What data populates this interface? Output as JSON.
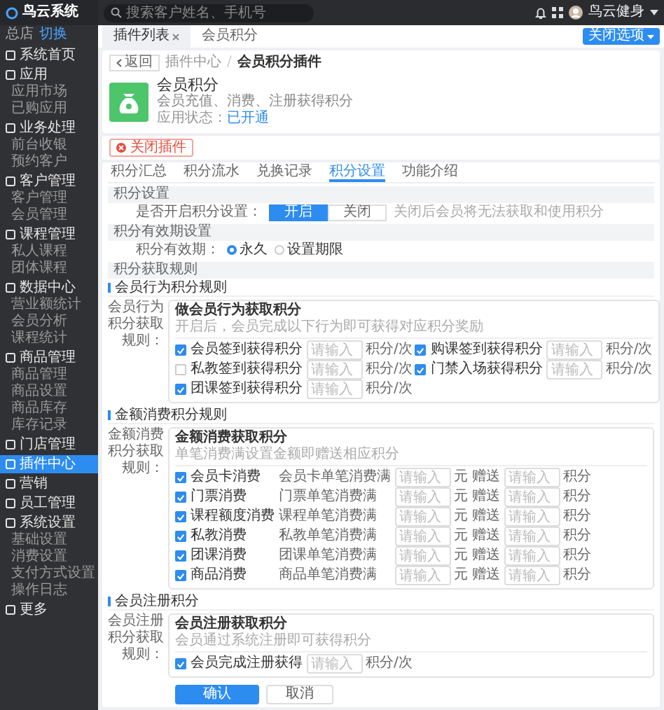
{
  "sidebar": {
    "brand": "鸟云系统",
    "store": "总店",
    "switch": "切换",
    "items": [
      {
        "label": "系统首页",
        "selected": false
      },
      {
        "label": "应用",
        "selected": false,
        "children": [
          {
            "label": "应用市场",
            "selected": false
          },
          {
            "label": "已购应用",
            "selected": false
          }
        ]
      },
      {
        "label": "业务处理",
        "selected": false,
        "children": [
          {
            "label": "前台收银",
            "selected": false
          },
          {
            "label": "预约客户",
            "selected": false
          }
        ]
      },
      {
        "label": "客户管理",
        "selected": false,
        "children": [
          {
            "label": "客户管理",
            "selected": false
          },
          {
            "label": "会员管理",
            "selected": false
          }
        ]
      },
      {
        "label": "课程管理",
        "selected": false,
        "children": [
          {
            "label": "私人课程",
            "selected": false
          },
          {
            "label": "团体课程",
            "selected": false
          }
        ]
      },
      {
        "label": "数据中心",
        "selected": false,
        "children": [
          {
            "label": "营业额统计",
            "selected": false
          },
          {
            "label": "会员分析",
            "selected": false
          },
          {
            "label": "课程统计",
            "selected": false
          }
        ]
      },
      {
        "label": "商品管理",
        "selected": false,
        "children": [
          {
            "label": "商品管理",
            "selected": false
          },
          {
            "label": "商品设置",
            "selected": false
          },
          {
            "label": "商品库存",
            "selected": false
          },
          {
            "label": "库存记录",
            "selected": false
          }
        ]
      },
      {
        "label": "门店管理",
        "selected": false
      },
      {
        "label": "插件中心",
        "selected": true
      },
      {
        "label": "营销",
        "selected": false
      },
      {
        "label": "员工管理",
        "selected": false
      },
      {
        "label": "系统设置",
        "selected": false,
        "children": [
          {
            "label": "基础设置",
            "selected": false
          },
          {
            "label": "消费设置",
            "selected": false
          },
          {
            "label": "支付方式设置",
            "selected": false
          },
          {
            "label": "操作日志",
            "selected": false
          }
        ]
      },
      {
        "label": "更多",
        "selected": false
      }
    ]
  },
  "topbar": {
    "search": {
      "placeholder": "搜索客户姓名、手机号"
    },
    "user": "鸟云健身"
  },
  "page_tabs": {
    "tabs": [
      {
        "label": "插件列表",
        "selected": true,
        "closable": true
      },
      {
        "label": "会员积分",
        "selected": false,
        "closable": false
      }
    ],
    "menu_button": "关闭选项"
  },
  "header": {
    "back": "返回",
    "breadcrumb": [
      "插件中心",
      "会员积分插件"
    ],
    "separator": "/",
    "plugin": {
      "name": "会员积分",
      "description": "会员充值、消费、注册获得积分",
      "status_label": "应用状态：",
      "status": "已开通"
    }
  },
  "close_button": "关闭插件",
  "tabs": [
    {
      "label": "积分汇总",
      "selected": false
    },
    {
      "label": "积分流水",
      "selected": false
    },
    {
      "label": "兑换记录",
      "selected": false
    },
    {
      "label": "积分设置",
      "selected": true
    },
    {
      "label": "功能介绍",
      "selected": false
    }
  ],
  "sections": [
    {
      "kind": "toggle",
      "title": "积分设置",
      "label": "是否开启积分设置：",
      "options": [
        {
          "label": "开启",
          "selected": true
        },
        {
          "label": "关闭",
          "selected": false
        }
      ],
      "hint": "关闭后会员将无法获取和使用积分"
    },
    {
      "kind": "radio",
      "title": "积分有效期设置",
      "label": "积分有效期：",
      "options": [
        {
          "label": "永久",
          "selected": true
        },
        {
          "label": "设置期限",
          "selected": false
        }
      ]
    },
    {
      "kind": "rules",
      "title": "积分获取规则",
      "groups": [
        {
          "kind": "behavior",
          "heading": "会员行为积分规则",
          "label": "会员行为积分获取规则：",
          "box_title": "做会员行为获取积分",
          "box_desc": "开启后，会员完成以下行为即可获得对应积分奖励",
          "items": [
            {
              "label": "会员签到获得积分",
              "checked": true,
              "placeholder": "请输入",
              "unit": "积分/次"
            },
            {
              "label": "购课签到获得积分",
              "checked": true,
              "placeholder": "请输入",
              "unit": "积分/次"
            },
            {
              "label": "私教签到获得积分",
              "checked": false,
              "placeholder": "请输入",
              "unit": "积分/次"
            },
            {
              "label": "门禁入场获得积分",
              "checked": true,
              "placeholder": "请输入",
              "unit": "积分/次"
            },
            {
              "label": "团课签到获得积分",
              "checked": true,
              "placeholder": "请输入",
              "unit": "积分/次"
            }
          ]
        },
        {
          "kind": "spending",
          "heading": "金额消费积分规则",
          "label": "金额消费积分获取规则：",
          "box_title": "金额消费获取积分",
          "box_desc": "单笔消费满设置金额即赠送相应积分",
          "items": [
            {
              "label": "会员卡消费",
              "checked": true,
              "condition": "会员卡单笔消费满",
              "amount": {
                "placeholder": "请输入",
                "unit": "元"
              },
              "reward_label": "赠送",
              "points": {
                "placeholder": "请输入",
                "unit": "积分"
              }
            },
            {
              "label": "门票消费",
              "checked": true,
              "condition": "门票单笔消费满",
              "amount": {
                "placeholder": "请输入",
                "unit": "元"
              },
              "reward_label": "赠送",
              "points": {
                "placeholder": "请输入",
                "unit": "积分"
              }
            },
            {
              "label": "课程额度消费",
              "checked": true,
              "condition": "课程单笔消费满",
              "amount": {
                "placeholder": "请输入",
                "unit": "元"
              },
              "reward_label": "赠送",
              "points": {
                "placeholder": "请输入",
                "unit": "积分"
              }
            },
            {
              "label": "私教消费",
              "checked": true,
              "condition": "私教单笔消费满",
              "amount": {
                "placeholder": "请输入",
                "unit": "元"
              },
              "reward_label": "赠送",
              "points": {
                "placeholder": "请输入",
                "unit": "积分"
              }
            },
            {
              "label": "团课消费",
              "checked": true,
              "condition": "团课单笔消费满",
              "amount": {
                "placeholder": "请输入",
                "unit": "元"
              },
              "reward_label": "赠送",
              "points": {
                "placeholder": "请输入",
                "unit": "积分"
              }
            },
            {
              "label": "商品消费",
              "checked": true,
              "condition": "商品单笔消费满",
              "amount": {
                "placeholder": "请输入",
                "unit": "元"
              },
              "reward_label": "赠送",
              "points": {
                "placeholder": "请输入",
                "unit": "积分"
              }
            }
          ]
        },
        {
          "kind": "register",
          "heading": "会员注册积分",
          "label": "会员注册积分获取规则：",
          "box_title": "会员注册获取积分",
          "box_desc": "会员通过系统注册即可获得积分",
          "items": [
            {
              "label": "会员完成注册获得",
              "checked": true,
              "placeholder": "请输入",
              "unit": "积分/次"
            }
          ]
        }
      ]
    }
  ],
  "actions": [
    {
      "label": "确认",
      "kind": "primary"
    },
    {
      "label": "取消",
      "kind": "default"
    }
  ]
}
